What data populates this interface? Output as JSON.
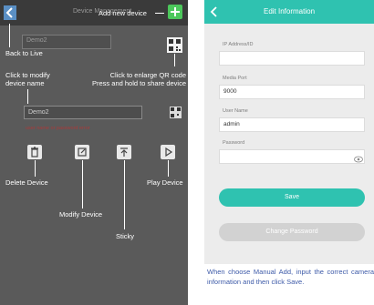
{
  "left": {
    "header_title": "Device Management",
    "add_new_device": "Add new device",
    "back_to_live": "Back to Live",
    "device_name_ghost": "Demo2",
    "click_to_modify_line1": "Click to modify",
    "click_to_modify_line2": "device name",
    "enlarge_qr_line1": "Click to enlarge QR code",
    "enlarge_qr_line2": "Press and hold to share device",
    "device_field_value": "Demo2",
    "error_text": "user name or password error",
    "delete_device": "Delete Device",
    "modify_device": "Modify Device",
    "sticky": "Sticky",
    "play_device": "Play Device"
  },
  "right": {
    "title": "Edit Information",
    "fields": [
      {
        "label": "IP Address/ID",
        "value": ""
      },
      {
        "label": "Media Port",
        "value": "9000"
      },
      {
        "label": "User Name",
        "value": "admin"
      },
      {
        "label": "Password",
        "value": ""
      }
    ],
    "save_label": "Save",
    "change_password_label": "Change Password"
  },
  "caption": "When choose Manual Add, input the correct camera information and then click Save.",
  "colors": {
    "accent": "#2fc2b0",
    "caption": "#3d5aa8"
  }
}
